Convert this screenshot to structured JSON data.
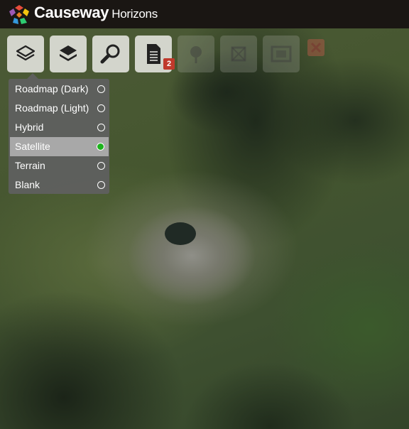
{
  "app": {
    "name": "Causeway",
    "subtitle": "Horizons",
    "logo_colors": [
      "#e74c3c",
      "#f1c40f",
      "#2ecc71",
      "#3498db",
      "#9b59b6"
    ]
  },
  "toolbar": {
    "buttons": [
      {
        "name": "basemap-layers",
        "icon": "layers-outline-icon",
        "enabled": true,
        "active": true
      },
      {
        "name": "layers",
        "icon": "layers-stack-icon",
        "enabled": true
      },
      {
        "name": "search",
        "icon": "magnifier-icon",
        "enabled": true
      },
      {
        "name": "documents",
        "icon": "document-icon",
        "enabled": true,
        "badge": "2"
      },
      {
        "name": "identify",
        "icon": "pin-icon",
        "enabled": false
      },
      {
        "name": "measure",
        "icon": "measure-icon",
        "enabled": false
      },
      {
        "name": "print",
        "icon": "frame-icon",
        "enabled": false
      },
      {
        "name": "clear",
        "icon": "close-x-icon",
        "enabled": false
      }
    ]
  },
  "basemap_menu": {
    "items": [
      {
        "label": "Roadmap (Dark)",
        "selected": false
      },
      {
        "label": "Roadmap (Light)",
        "selected": false
      },
      {
        "label": "Hybrid",
        "selected": false
      },
      {
        "label": "Satellite",
        "selected": true
      },
      {
        "label": "Terrain",
        "selected": false
      },
      {
        "label": "Blank",
        "selected": false
      }
    ],
    "selected_color": "#1db31d"
  }
}
